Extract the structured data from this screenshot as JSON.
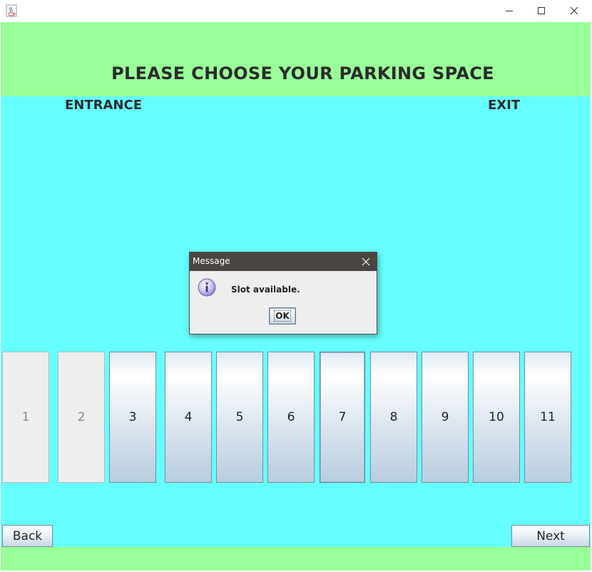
{
  "window": {
    "icon": "java-coffee-cup-icon",
    "controls": [
      "minimize-icon",
      "maximize-icon",
      "close-icon"
    ]
  },
  "header": {
    "title": "PLEASE CHOOSE YOUR PARKING SPACE",
    "background": "#99ff99"
  },
  "main": {
    "background": "#66ffff",
    "entrance_label": "ENTRANCE",
    "exit_label": "EXIT"
  },
  "slots": [
    {
      "label": "1",
      "enabled": false
    },
    {
      "label": "2",
      "enabled": false
    },
    {
      "label": "3",
      "enabled": true
    },
    {
      "label": "4",
      "enabled": true
    },
    {
      "label": "5",
      "enabled": true
    },
    {
      "label": "6",
      "enabled": true
    },
    {
      "label": "7",
      "enabled": true,
      "focused": true
    },
    {
      "label": "8",
      "enabled": true
    },
    {
      "label": "9",
      "enabled": true
    },
    {
      "label": "10",
      "enabled": true
    },
    {
      "label": "11",
      "enabled": true
    }
  ],
  "nav": {
    "back_label": "Back",
    "next_label": "Next"
  },
  "dialog": {
    "title": "Message",
    "icon": "info-icon",
    "message": "Slot available.",
    "ok_label": "OK"
  }
}
